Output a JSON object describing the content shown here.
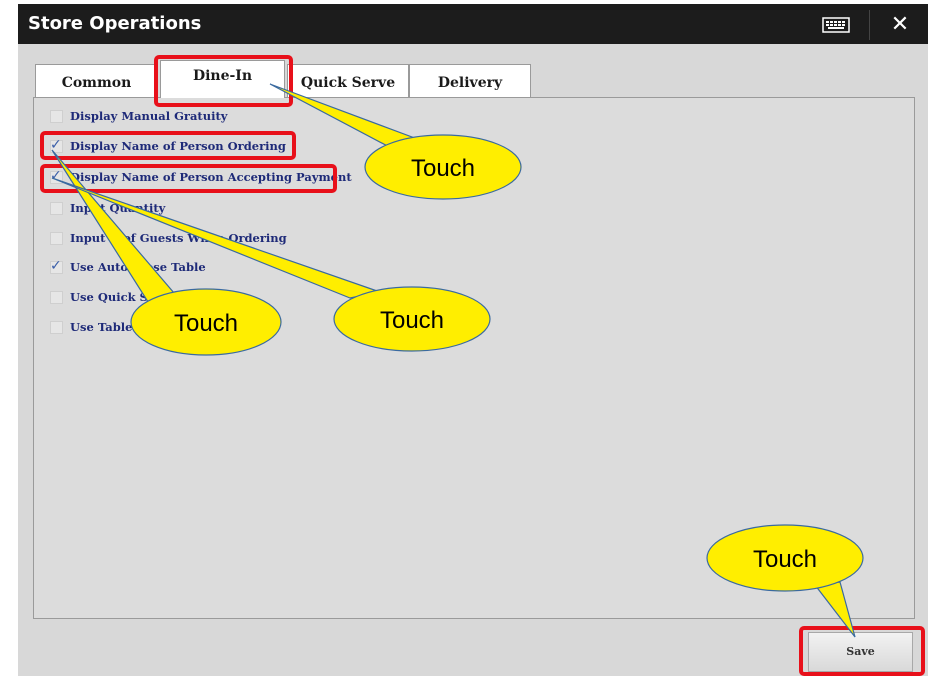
{
  "window": {
    "title": "Store Operations"
  },
  "header": {
    "keyboard_icon": "keyboard-icon",
    "close_icon": "close-icon",
    "close_glyph": "✕"
  },
  "tabs": [
    {
      "label": "Common",
      "active": false
    },
    {
      "label": "Dine-In",
      "active": true
    },
    {
      "label": "Quick Serve",
      "active": false
    },
    {
      "label": "Delivery",
      "active": false
    }
  ],
  "options": [
    {
      "label": "Display Manual Gratuity",
      "checked": false
    },
    {
      "label": "Display Name of Person Ordering",
      "checked": true
    },
    {
      "label": "Display Name of Person Accepting Payment",
      "checked": true
    },
    {
      "label": "Input Quantity",
      "checked": false
    },
    {
      "label": "Input # of Guests When Ordering",
      "checked": false
    },
    {
      "label": "Use Auto Close Table",
      "checked": true
    },
    {
      "label": "Use Quick Sell",
      "checked": false
    },
    {
      "label": "Use Table",
      "checked": false
    }
  ],
  "footer": {
    "save_label": "Save"
  },
  "annotations": {
    "callouts": [
      "Touch",
      "Touch",
      "Touch",
      "Touch"
    ],
    "highlight_color": "#e8101a",
    "callout_fill": "#ffee00"
  }
}
